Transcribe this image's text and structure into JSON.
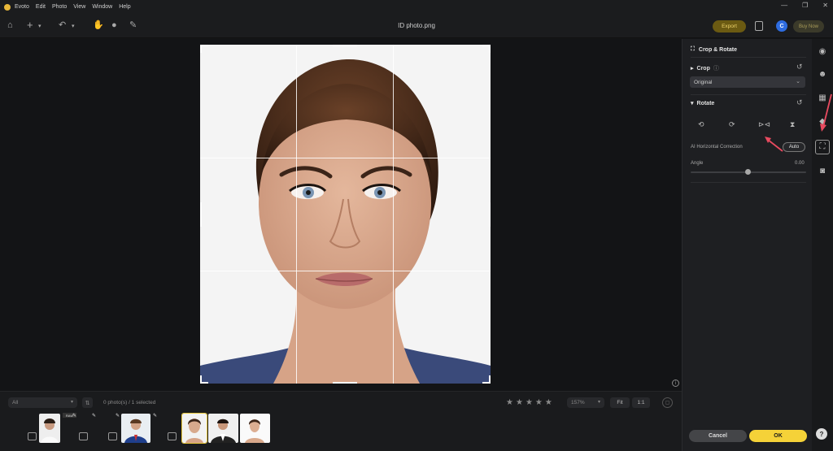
{
  "app": {
    "name": "Evoto"
  },
  "menu": [
    "Edit",
    "Photo",
    "View",
    "Window",
    "Help"
  ],
  "toolbar": {
    "doc_title": "ID photo.png",
    "export_label": "Export",
    "avatar_initial": "C",
    "buy_label": "Buy Now"
  },
  "filmstrip": {
    "filter_value": "All",
    "status": "0 photo(s) / 1 selected",
    "rating_stars": 5,
    "zoom": "157%",
    "fit_label": "Fit",
    "one_label": "1:1",
    "raw_tag": "RAW"
  },
  "panel": {
    "title": "Crop & Rotate",
    "crop": {
      "title": "Crop",
      "selected": "Original"
    },
    "rotate": {
      "title": "Rotate"
    },
    "ai_label": "AI Horizontal Correction",
    "auto_label": "Auto",
    "angle_label": "Angle",
    "angle_value": "0.00",
    "cancel_label": "Cancel",
    "ok_label": "OK"
  },
  "colors": {
    "accent": "#f5d238",
    "annotation": "#e84a5f"
  }
}
